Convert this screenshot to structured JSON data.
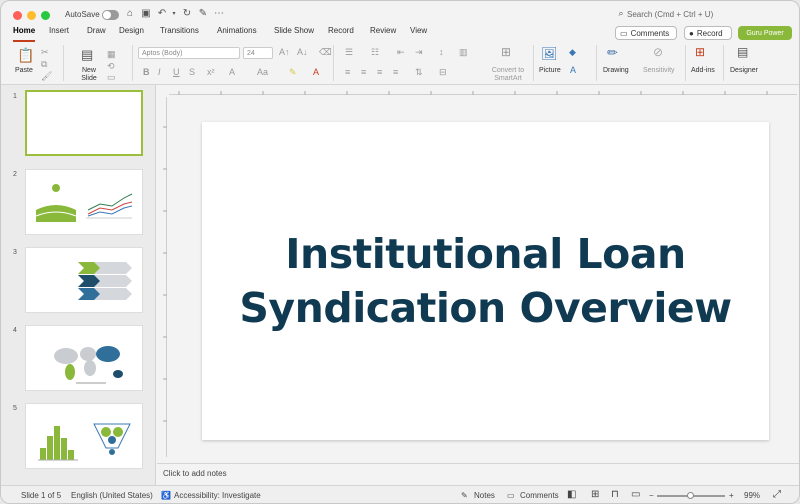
{
  "title_bar": {
    "autosave_label": "AutoSave",
    "search_placeholder": "Search (Cmd + Ctrl + U)"
  },
  "tabs": [
    "Home",
    "Insert",
    "Draw",
    "Design",
    "Transitions",
    "Animations",
    "Slide Show",
    "Record",
    "Review",
    "View"
  ],
  "header_buttons": {
    "comments": "Comments",
    "record": "Record",
    "guru": "Guru Power"
  },
  "ribbon": {
    "paste": "Paste",
    "new_slide": "New Slide",
    "font_name": "Aptos (Body)",
    "font_size": "24",
    "convert_smartart": "Convert to SmartArt",
    "picture": "Picture",
    "drawing": "Drawing",
    "sensitivity": "Sensitivity",
    "addins": "Add-ins",
    "designer": "Designer"
  },
  "slides": {
    "numbers": [
      "1",
      "2",
      "3",
      "4",
      "5"
    ],
    "current_title": "Institutional Loan Syndication Overview",
    "line1": "Institutional Loan",
    "line2": "Syndication Overview"
  },
  "notes_placeholder": "Click to add notes",
  "status": {
    "slide_of": "Slide 1 of 5",
    "language": "English (United States)",
    "accessibility": "Accessibility: Investigate",
    "notes": "Notes",
    "comments": "Comments",
    "zoom": "99%",
    "zoom_fraction": 0.5
  },
  "colors": {
    "accent_green": "#8ab83a",
    "title_navy": "#0f3a52",
    "tab_accent": "#c43e1c"
  }
}
